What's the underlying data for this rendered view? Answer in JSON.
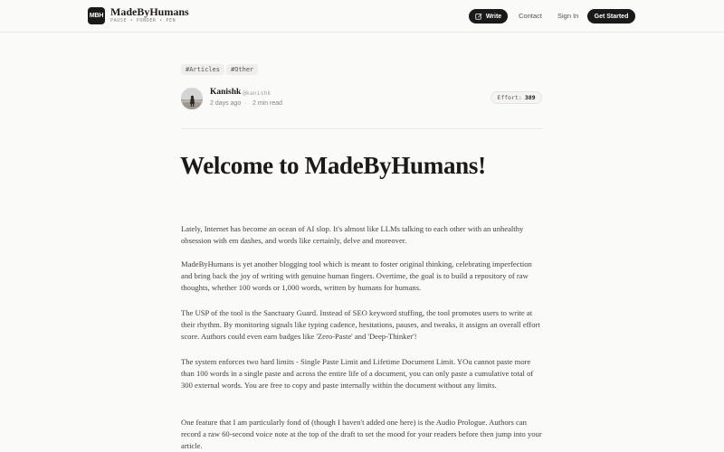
{
  "header": {
    "logo_text": "MBH",
    "brand_name": "MadeByHumans",
    "tagline": "PAUSE • PONDER • PEN",
    "write_label": "Write",
    "contact_label": "Contact",
    "signin_label": "Sign In",
    "get_started_label": "Get Started"
  },
  "post": {
    "tags": [
      "#Articles",
      "#Other"
    ],
    "author": {
      "name": "Kanishk",
      "handle": "@kanishk",
      "posted": "2 days ago",
      "separator": "·",
      "read_time": "2 min read"
    },
    "effort": {
      "label": "Effort:",
      "value": "389"
    },
    "title": "Welcome to MadeByHumans!",
    "paragraphs": [
      "Lately, Internet has become an ocean of AI slop. It's almost like LLMs talking to each other with an unhealthy obsession with em dashes, and words like certainly, delve and moreover.",
      "MadeByHumans is yet another blogging tool which is meant to foster original thinking, celebrating imperfection  and bring back the joy of writing with genuine human fingers. Overtime, the goal is to build a repository of raw thoughts, whether 100 words or 1,000 words, written by humans for humans.",
      "The USP of the tool is the Sanctuary Guard. Instead of SEO keyword stuffing, the tool promotes users to write at their rhythm. By monitoring signals like typing cadence, hesitations, pauses, and tweaks, it assigns an overall effort score. Authors could even earn badges like 'Zero-Paste' and 'Deep-Thinker'!",
      "The system enforces two hard limits - Single Paste Limit and Lifetime Document Limit. YOu cannot paste more than 100 words in a single paste and across the entire life of a document, you can only paste a cumulative total of 300 external words. You are free to copy and paste internally within the document without any limits.",
      "One feature that I am particularly fond of (though I haven't added one here) is the Audio Prologue. Authors can record a raw 60-second voice note at the top of the draft to set the mood for your readers before then jump into your article."
    ]
  }
}
